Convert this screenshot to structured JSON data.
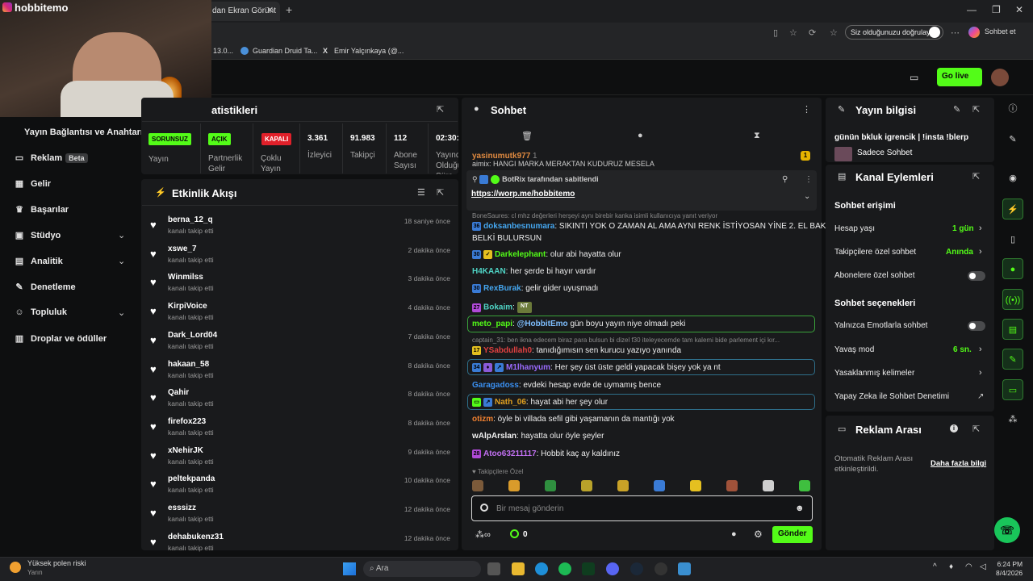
{
  "overlay": {
    "handle": "hobbitemo"
  },
  "browser": {
    "active_tab": "dan Ekran Görünt",
    "close_glyph": "✕",
    "new_tab_glyph": "+",
    "privacy_label": "Siz olduğunuzu doğrulayın",
    "copilot_label": "Sohbet et",
    "bookmarks": [
      "13.0...",
      "Guardian Druid Ta...",
      "Emir Yalçınkaya (@..."
    ]
  },
  "header": {
    "go_live": "Go live"
  },
  "nav": {
    "connection": "Yayın Bağlantısı ve Anahtarı",
    "items": [
      {
        "label": "Reklam",
        "icon": "megaphone-icon",
        "glyph": "▭"
      },
      {
        "label": "Gelir",
        "icon": "revenue-icon",
        "glyph": "▦"
      },
      {
        "label": "Başarılar",
        "icon": "trophy-icon",
        "glyph": "♛"
      },
      {
        "label": "Stüdyo",
        "icon": "studio-icon",
        "glyph": "▣"
      },
      {
        "label": "Analitik",
        "icon": "analytics-icon",
        "glyph": "▤"
      },
      {
        "label": "Denetleme",
        "icon": "wrench-icon",
        "glyph": "✎"
      },
      {
        "label": "Topluluk",
        "icon": "community-icon",
        "glyph": "☺"
      },
      {
        "label": "Droplar ve ödüller",
        "icon": "gift-icon",
        "glyph": "▥"
      }
    ],
    "beta_label": "Beta"
  },
  "stats": {
    "title": "atistikleri",
    "stream_badge": "SORUNSUZ",
    "stream_label": "Yayın",
    "partner_badge": "AÇIK",
    "partner_label": "Partnerlik Gelir",
    "multistream_badge": "KAPALI",
    "multistream_label": "Çoklu Yayın",
    "viewers_value": "3.361",
    "viewers_label": "İzleyici",
    "followers_value": "91.983",
    "followers_label": "Takipçi",
    "subs_value": "112",
    "subs_label": "Abone Sayısı",
    "uptime_value": "02:30:",
    "uptime_label": "Yayında Olduğu Süre"
  },
  "activity": {
    "title": "Etkinlik Akışı",
    "sub": "kanalı takip etti",
    "rows": [
      {
        "name": "berna_12_q",
        "time": "18 saniye önce"
      },
      {
        "name": "xswe_7",
        "time": "2 dakika önce"
      },
      {
        "name": "Winmilss",
        "time": "3 dakika önce"
      },
      {
        "name": "KirpiVoice",
        "time": "4 dakika önce"
      },
      {
        "name": "Dark_Lord04",
        "time": "7 dakika önce"
      },
      {
        "name": "hakaan_58",
        "time": "8 dakika önce"
      },
      {
        "name": "Qahir",
        "time": "8 dakika önce"
      },
      {
        "name": "firefox223",
        "time": "8 dakika önce"
      },
      {
        "name": "xNehirJK",
        "time": "9 dakika önce"
      },
      {
        "name": "peltekpanda",
        "time": "10 dakika önce"
      },
      {
        "name": "esssizz",
        "time": "12 dakika önce"
      },
      {
        "name": "dehabukenz31",
        "time": "12 dakika önce"
      }
    ]
  },
  "chat": {
    "title": "Sohbet",
    "top_user": "yasinumutk977",
    "top_user_count": "1",
    "top_partial": "aimix: HANGI MARKA MERAKTAN KUDURUZ MESELA",
    "pinned_by": "BotRix tarafından sabitlendi",
    "pinned_link": "https://worp.me/hobbitemo",
    "reply_1": "BoneSaures: cl mhz değerleri herşeyi aynı birebir kanka isimli kullanıcıya yanıt veriyor",
    "m1_name": "doksanbesnumara",
    "m1_text": ": SIKINTI YOK O ZAMAN AL AMA AYNI RENK İSTİYOSAN YİNE 2. EL BAK",
    "m1_text2": "BELKİ BULURSUN",
    "m2_name": "Darkelephant",
    "m2_text": ": olur abi hayatta olur",
    "m3_name": "H4KAAN",
    "m3_text": ": her şerde bi hayır vardır",
    "m4_name": "RexBurak",
    "m4_text": ": gelir gider uyuşmadı",
    "m5_name": "Bokaim",
    "m5_text": ":",
    "m6_name": "meto_papi",
    "m6_text": "gün boyu yayın niye olmadı peki",
    "m6_mention": "@HobbitEmo",
    "reply_2": "captain_31: ben ikna edecem biraz para bulsun bi dizel f30 iteleyecemde tam kalemi bide parlement içi kır...",
    "m7_name": "YSabdullah0",
    "m7_text": ": tanıdığımısın sen kurucu yazıyo yanında",
    "m8_name": "M1lhanyum",
    "m8_text": ": Her şey üst üste geldi yapacak bişey yok ya nt",
    "m9_name": "Garagadoss",
    "m9_text": ": evdeki hesap evde de uymamış bence",
    "m10_name": "Nath_06",
    "m10_text": ": hayat abi her şey olur",
    "m11_name": "otizm",
    "m11_text": ": öyle bi villada sefil gibi yaşamanın da mantığı yok",
    "m12_name": "wAlpArslan",
    "m12_text": ": hayatta olur öyle şeyler",
    "m13_name": "Atoo63211117",
    "m13_text": ": Hobbit kaç ay kaldınız",
    "followers_only": "Takipçilere Özel",
    "input_placeholder": "Bir mesaj gönderin",
    "points": "0",
    "send": "Gönder",
    "emote_colors": [
      "#7b5a3a",
      "#d99b2b",
      "#2f8f3f",
      "#b8a22a",
      "#c9a227",
      "#3a7bd5",
      "#e5c020",
      "#a0523a",
      "#cfcfcf",
      "#3fbf3f"
    ]
  },
  "stream_info": {
    "title": "Yayın bilgisi",
    "stream_title": "günün bkluk igrencik | !insta !blerp",
    "category": "Sadece Sohbet"
  },
  "channel_actions": {
    "title": "Kanal Eylemleri",
    "chat_access": "Sohbet erişimi",
    "account_age": "Hesap yaşı",
    "account_age_value": "1 gün",
    "followers_only": "Takipçilere özel sohbet",
    "followers_only_value": "Anında",
    "subs_only": "Abonelere özel sohbet",
    "chat_options": "Sohbet seçenekleri",
    "emote_only": "Yalnızca Emotlarla sohbet",
    "slow_mode": "Yavaş mod",
    "slow_mode_value": "6 sn.",
    "banned_words": "Yasaklanmış kelimeler",
    "ai_moderation": "Yapay Zeka ile Sohbet Denetimi"
  },
  "ad_break": {
    "title": "Reklam Arası",
    "desc": "Otomatik Reklam Arası etkinleştirildi.",
    "more": "Daha fazla bilgi"
  },
  "taskbar": {
    "weather": "Yüksek polen riski",
    "weather_sub": "Yarın",
    "search": "Ara",
    "time": "6:24 PM",
    "date": "8/4/2026"
  },
  "colors": {
    "kick_green": "#53fc18"
  }
}
